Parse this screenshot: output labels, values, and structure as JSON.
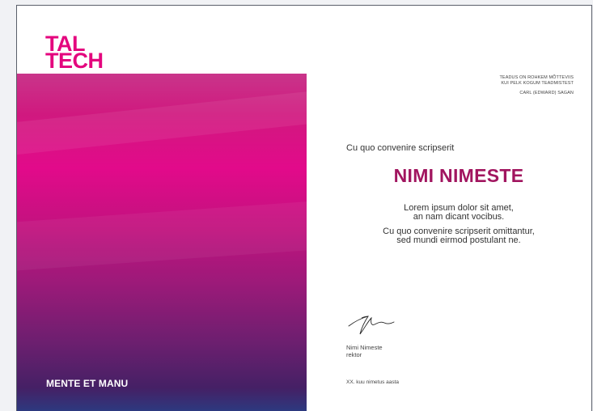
{
  "logo": {
    "line1": "TAL",
    "line2": "TECH"
  },
  "motto": "MENTE ET MANU",
  "quote": {
    "line1": "TEADUS ON ROHKEM MÕTTEVIIS",
    "line2": "KUI PELK KOGUM TEADMISTEST",
    "author": "CARL (EDWARD) SAGAN"
  },
  "certificate": {
    "intro": "Cu quo convenire scripserit",
    "name": "NIMI NIMESTE",
    "body": [
      "Lorem ipsum dolor sit amet,",
      "an nam dicant vocibus.",
      "Cu quo convenire scripserit omittantur,",
      "sed mundi eirmod postulant ne."
    ]
  },
  "signer": {
    "name": "Nimi Nimeste",
    "title": "rektor"
  },
  "date": "XX. kuu nimetus aasta",
  "colors": {
    "brand_magenta": "#e4067e",
    "name_color": "#a1155f",
    "gradient_bottom": "#2c3a80"
  }
}
